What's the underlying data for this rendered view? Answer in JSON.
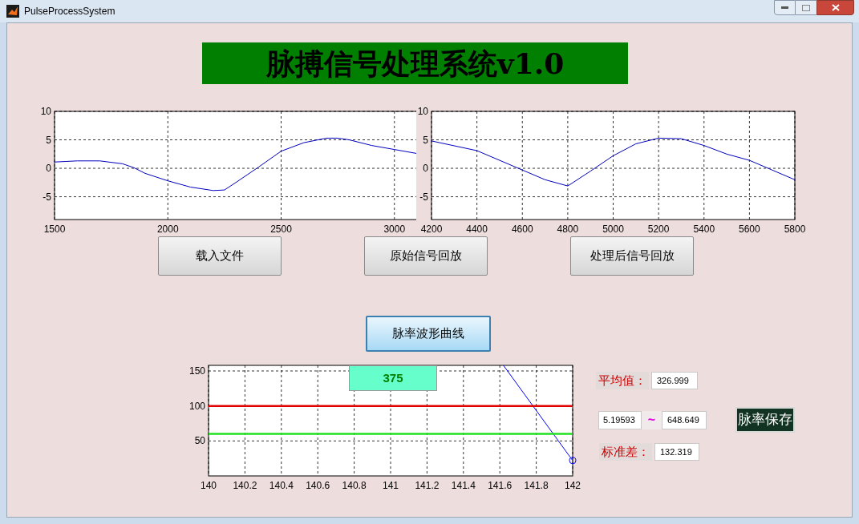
{
  "window": {
    "title": "PulseProcessSystem"
  },
  "header": {
    "title": "脉搏信号处理系统v1.0"
  },
  "raw_plot": {
    "chart_data": {
      "type": "line",
      "grid": true,
      "x": [
        1500,
        1550,
        1600,
        1700,
        1800,
        1850,
        1900,
        2000,
        2100,
        2200,
        2250,
        2300,
        2400,
        2500,
        2600,
        2700,
        2750,
        2800,
        2900,
        3000,
        3100
      ],
      "series": [
        {
          "color": "#0000c0",
          "values": [
            1.1,
            1.2,
            1.3,
            1.3,
            0.8,
            0.1,
            -0.9,
            -2.2,
            -3.3,
            -3.9,
            -3.8,
            -2.5,
            0.2,
            3.0,
            4.5,
            5.3,
            5.3,
            5.0,
            4.0,
            3.3,
            2.6
          ]
        }
      ],
      "xlim": [
        1500,
        3100
      ],
      "ylim": [
        -9,
        10
      ],
      "xticks": [
        1500,
        2000,
        2500,
        3000
      ],
      "yticks": [
        -5,
        0,
        5,
        10
      ]
    }
  },
  "processed_plot": {
    "chart_data": {
      "type": "line",
      "grid": true,
      "x": [
        4200,
        4400,
        4600,
        4700,
        4800,
        4900,
        5000,
        5100,
        5200,
        5300,
        5400,
        5500,
        5600,
        5700,
        5800
      ],
      "series": [
        {
          "color": "#0000c0",
          "values": [
            4.8,
            3.1,
            -0.3,
            -2.0,
            -3.1,
            -0.5,
            2.2,
            4.3,
            5.3,
            5.2,
            4.0,
            2.5,
            1.4,
            -0.3,
            -2.0
          ]
        }
      ],
      "xlim": [
        4200,
        5800
      ],
      "ylim": [
        -9,
        10
      ],
      "xticks": [
        4200,
        4400,
        4600,
        4800,
        5000,
        5200,
        5400,
        5600,
        5800
      ],
      "yticks": [
        -5,
        0,
        5,
        10
      ]
    }
  },
  "buttons": [
    {
      "label": "载入文件"
    },
    {
      "label": "原始信号回放"
    },
    {
      "label": "处理后信号回放"
    }
  ],
  "pulse_button": {
    "label": "脉率波形曲线",
    "focused": true
  },
  "rate_plot": {
    "chart_data": {
      "type": "line",
      "grid": true,
      "x": [
        140,
        141.62,
        142
      ],
      "series": [
        {
          "color": "#0000ff",
          "values": [
            null,
            158,
            22
          ]
        },
        {
          "color": "#e00000",
          "values": [
            100,
            100,
            100
          ]
        },
        {
          "color": "#20e020",
          "values": [
            60,
            60,
            60
          ]
        }
      ],
      "xlim": [
        140,
        142
      ],
      "ylim": [
        0,
        158
      ],
      "xticks": [
        140,
        140.2,
        140.4,
        140.6,
        140.8,
        141,
        141.2,
        141.4,
        141.6,
        141.8,
        142
      ],
      "yticks": [
        50,
        100,
        150
      ],
      "annotations": [
        {
          "text": "375"
        }
      ]
    }
  },
  "stats": {
    "mean_label": "平均值：",
    "mean": "326.999",
    "range_min": "5.19593",
    "range_sep": "~",
    "range_max": "648.649",
    "std_label": "标准差：",
    "std": "132.319"
  },
  "save_button": {
    "label": "脉率保存"
  }
}
